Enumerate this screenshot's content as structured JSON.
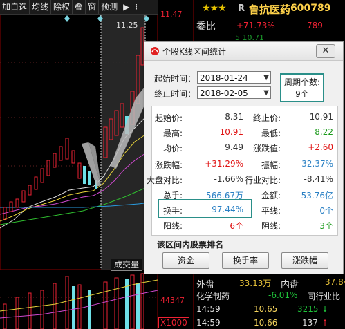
{
  "toolbar": {
    "buttons": [
      "加自选",
      "均线",
      "除权",
      "叠",
      "窗",
      "预测"
    ],
    "icon_play": "▶",
    "icon_menu": "⁝"
  },
  "chart": {
    "price_top": "11.47",
    "price_marker": "11.25",
    "volume_label": "44347",
    "volume_unit": "X1000",
    "volume_button": "成交量"
  },
  "stock": {
    "stars": "★★★",
    "prefix": "R",
    "name": "鲁抗医药",
    "code": "600789",
    "weibi_label": "委比",
    "weibi_value": "+71.73%",
    "weibi_value2": "789",
    "row5": "5       10.71"
  },
  "quote": {
    "waipan_label": "外盘",
    "waipan_value": "33.13万",
    "neipan_label": "内盘",
    "neipan_value": "37.84",
    "sector_name": "化学制药",
    "sector_change": "-6.01%",
    "sector_compare": "同行业比",
    "ticks": [
      {
        "time": "14:59",
        "price": "10.65",
        "volume": "3215",
        "dir": "↓"
      },
      {
        "time": "14:59",
        "price": "10.66",
        "volume": "137",
        "dir": "↑"
      }
    ]
  },
  "dialog": {
    "title": "个股K线区间统计",
    "close": "✕",
    "start_label": "起始时间：",
    "start_value": "2018-01-24",
    "end_label": "终止时间：",
    "end_value": "2018-02-05",
    "period_label": "周期个数:",
    "period_value": "9个",
    "stats": {
      "start_price_label": "起始价:",
      "start_price": "8.31",
      "end_price_label": "终止价:",
      "end_price": "10.91",
      "high_label": "最高:",
      "high": "10.91",
      "low_label": "最低:",
      "low": "8.22",
      "avg_label": "均价:",
      "avg": "9.49",
      "change_label": "涨跌值:",
      "change": "+2.60",
      "pct_label": "涨跌幅:",
      "pct": "+31.29%",
      "amp_label": "振幅:",
      "amp": "32.37%",
      "index_label": "大盘对比:",
      "index": "-1.66%",
      "industry_label": "行业对比:",
      "industry": "-8.41%",
      "vol_label": "总手:",
      "vol": "566.67万",
      "amount_label": "金额:",
      "amount": "53.76亿",
      "turnover_label": "换手:",
      "turnover": "97.44%",
      "flat_label": "平线:",
      "flat": "0个",
      "up_label": "阳线:",
      "up": "6个",
      "down_label": "阴线:",
      "down": "3个"
    },
    "ranking_title": "该区间内股票排名",
    "buttons": [
      "资金",
      "换手率",
      "涨跌幅"
    ]
  }
}
